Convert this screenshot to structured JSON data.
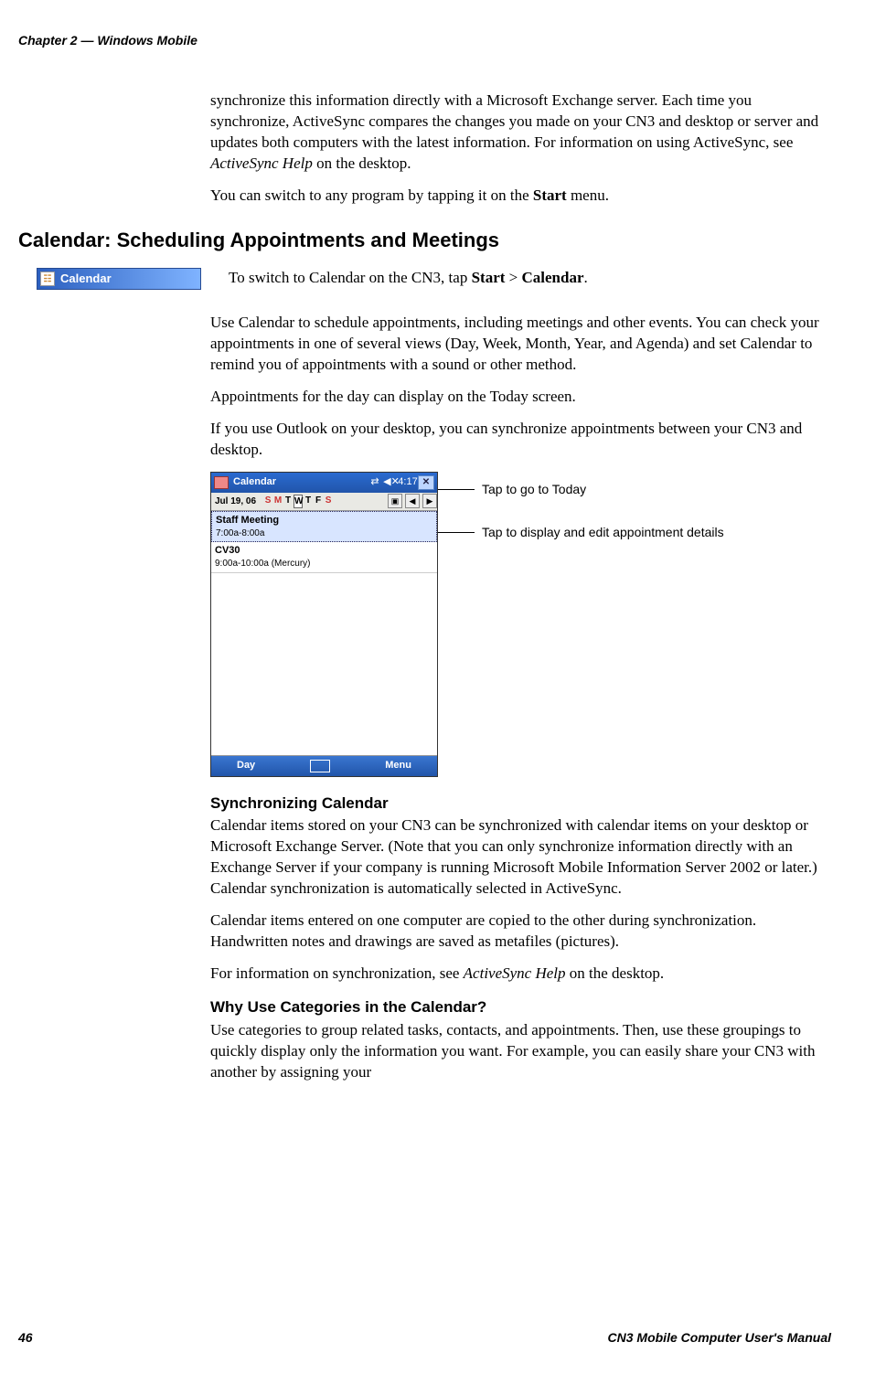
{
  "running_head": "Chapter 2 — Windows Mobile",
  "intro_p1_a": "synchronize this information directly with a Microsoft Exchange server. Each time you synchronize, ActiveSync compares the changes you made on your CN3 and desktop or server and updates both computers with the latest information. For information on using ActiveSync, see ",
  "intro_p1_ital": "ActiveSync Help",
  "intro_p1_b": " on the desktop.",
  "intro_p2_a": "You can switch to any program by tapping it on the ",
  "intro_p2_bold": "Start",
  "intro_p2_b": " menu.",
  "section_heading": "Calendar: Scheduling Appointments and Meetings",
  "menu_chip_label": "Calendar",
  "switch_line_a": "To switch to Calendar on the CN3, tap ",
  "switch_bold1": "Start",
  "switch_gt": " > ",
  "switch_bold2": "Calendar",
  "switch_line_b": ".",
  "use_cal_p": "Use Calendar to schedule appointments, including meetings and other events. You can check your appointments in one of several views (Day, Week, Month, Year, and Agenda) and set Calendar to remind you of appointments with a sound or other method.",
  "appts_today": "Appointments for the day can display on the Today screen.",
  "outlook_sync": "If you use Outlook on your desktop, you can synchronize appointments between your CN3 and desktop.",
  "pda": {
    "title": "Calendar",
    "time": "4:17",
    "close": "✕",
    "date": "Jul  19, 06",
    "dow": {
      "s1": "S",
      "m": "M",
      "t1": "T",
      "w": "W",
      "t2": "T",
      "f": "F",
      "s2": "S"
    },
    "nav_note": "▣",
    "nav_left": "◀",
    "nav_right": "▶",
    "appt1_title": "Staff Meeting",
    "appt1_time": "7:00a-8:00a",
    "appt2_title": "CV30",
    "appt2_time": "9:00a-10:00a (Mercury)",
    "soft_left": "Day",
    "soft_right": "Menu"
  },
  "callout_today": "Tap to go to Today",
  "callout_details": "Tap to display and edit appointment details",
  "sync_heading": "Synchronizing Calendar",
  "sync_p1": "Calendar items stored on your CN3 can be synchronized with calendar items on your desktop or Microsoft Exchange Server. (Note that you can only synchronize information directly with an Exchange Server if your company is running Microsoft Mobile Information Server 2002 or later.) Calendar synchronization is automatically selected in ActiveSync.",
  "sync_p2": "Calendar items entered on one computer are copied to the other during synchronization. Handwritten notes and drawings are saved as metafiles (pictures).",
  "sync_p3_a": "For information on synchronization, see ",
  "sync_p3_ital": "ActiveSync Help",
  "sync_p3_b": " on the desktop.",
  "why_heading": "Why Use Categories in the Calendar?",
  "why_p": "Use categories to group related tasks, contacts, and appointments. Then, use these groupings to quickly display only the information you want. For example, you can easily share your CN3 with another by assigning your",
  "footer_page": "46",
  "footer_book": "CN3 Mobile Computer User's Manual"
}
